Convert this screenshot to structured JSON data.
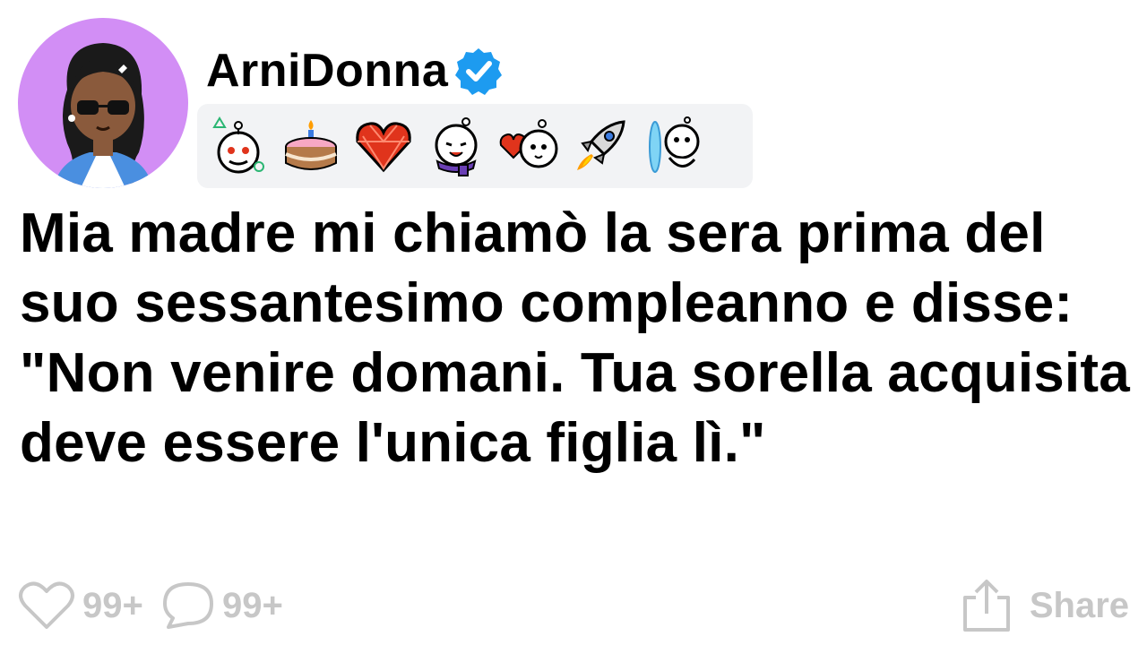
{
  "post": {
    "author": "ArniDonna",
    "verified": true,
    "title": "Mia madre mi chiamò la sera prima del suo sessantesimo compleanno e disse: \"Non venire domani. Tua sorella acquisita deve essere l'unica figlia lì.\""
  },
  "badges": [
    {
      "icon": "snoo-shapes-icon"
    },
    {
      "icon": "birthday-cake-icon"
    },
    {
      "icon": "red-gem-heart-icon"
    },
    {
      "icon": "snoo-purple-scarf-icon"
    },
    {
      "icon": "snoo-heart-balloon-icon"
    },
    {
      "icon": "rocket-icon"
    },
    {
      "icon": "snoo-portal-icon"
    }
  ],
  "actions": {
    "likes": "99+",
    "comments": "99+",
    "share_label": "Share"
  },
  "colors": {
    "avatar_background": "#d28ef5",
    "verified_blue": "#1d9bf0",
    "action_gray": "#c7c7c7",
    "badge_strip": "#f2f3f5"
  }
}
